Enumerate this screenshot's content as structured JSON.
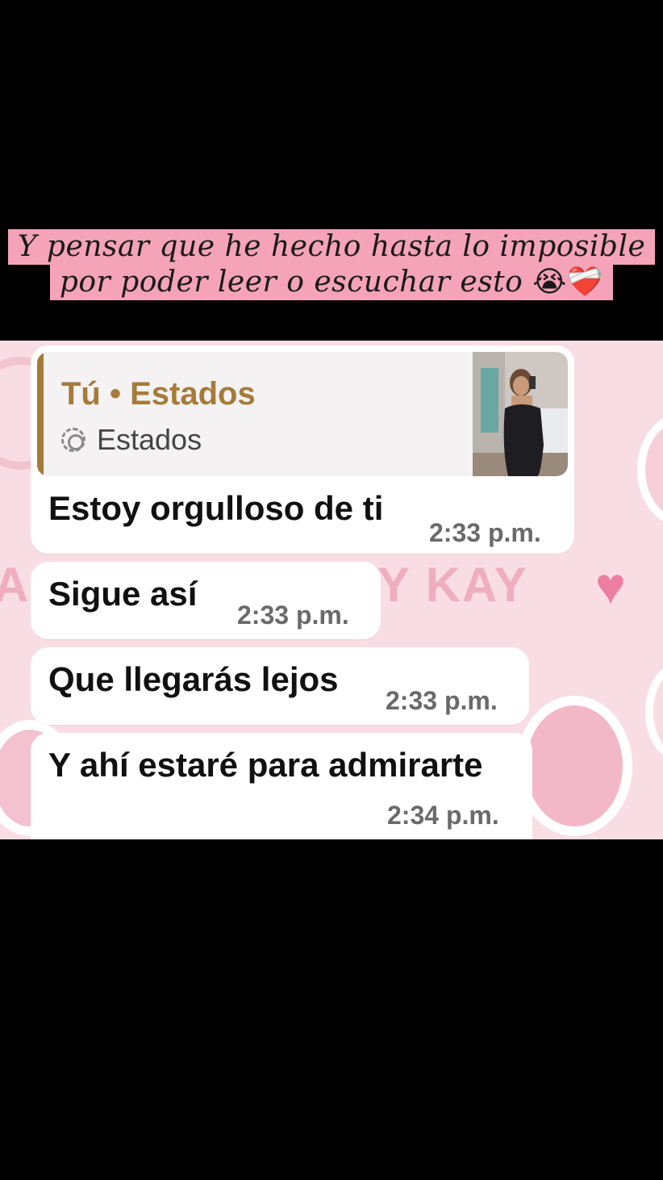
{
  "caption": {
    "line1": "Y pensar que he hecho hasta lo imposible",
    "line2": "por poder leer o escuchar esto",
    "line2_emoji": "😭❤️‍🩹"
  },
  "wallpaper": {
    "text_left": "A",
    "text_right": "Y KAY",
    "heart_glyph": "♥"
  },
  "reply_quote": {
    "title": "Tú • Estados",
    "subtitle": "Estados",
    "icon": "status-icon",
    "thumbnail": "photo-thumbnail"
  },
  "messages": [
    {
      "text": "Estoy orgulloso de ti",
      "time": "2:33 p.m."
    },
    {
      "text": "Sigue así",
      "time": "2:33 p.m."
    },
    {
      "text": "Que llegarás lejos",
      "time": "2:33 p.m."
    },
    {
      "text": "Y ahí estaré para admirarte",
      "time": "2:34 p.m."
    }
  ],
  "colors": {
    "caption_bg": "#f4a3b8",
    "chat_bg": "#f9dde4",
    "quote_accent": "#a57b3a"
  }
}
